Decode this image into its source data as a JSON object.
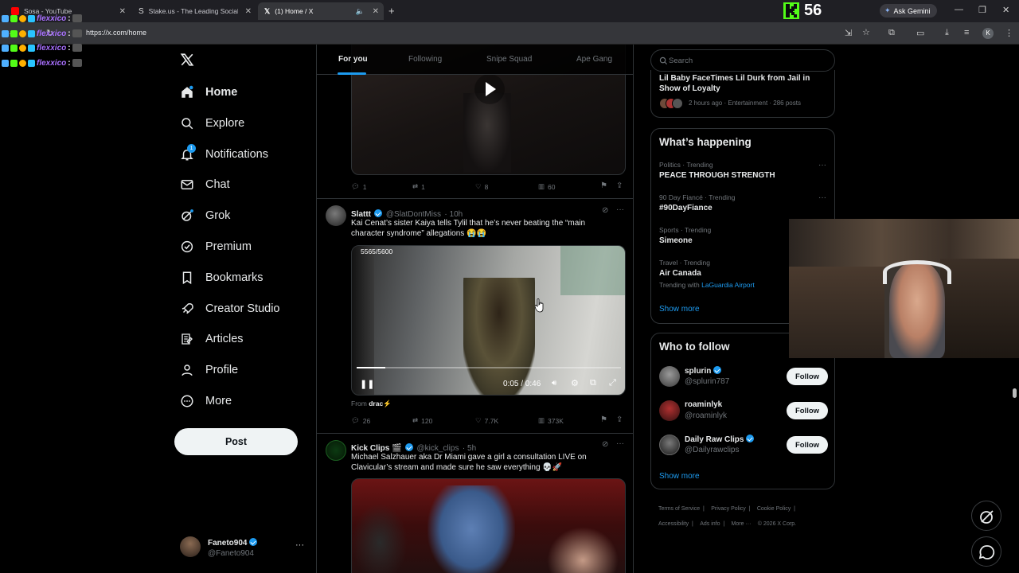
{
  "browser": {
    "tabs": [
      {
        "label": "Sosa - YouTube"
      },
      {
        "label": "Stake.us - The Leading Social C"
      },
      {
        "label": "(1) Home / X"
      }
    ],
    "url": "https://x.com/home",
    "new_tab": "+",
    "ask_gemini": "Ask Gemini",
    "kick_count": "56",
    "profile_letter": "K"
  },
  "overlay": {
    "chat_names": [
      "flexxico",
      "flexxico",
      "flexxico",
      "flexxico"
    ],
    "chat_sep": ":"
  },
  "nav": {
    "items": [
      {
        "label": "Home"
      },
      {
        "label": "Explore"
      },
      {
        "label": "Notifications",
        "badge": "1"
      },
      {
        "label": "Chat"
      },
      {
        "label": "Grok"
      },
      {
        "label": "Premium"
      },
      {
        "label": "Bookmarks"
      },
      {
        "label": "Creator Studio"
      },
      {
        "label": "Articles"
      },
      {
        "label": "Profile"
      },
      {
        "label": "More"
      }
    ],
    "post_label": "Post",
    "account": {
      "name": "Faneto904",
      "handle": "@Faneto904"
    }
  },
  "feed": {
    "tabs": [
      "For you",
      "Following",
      "Snipe Squad",
      "Ape Gang"
    ],
    "tweet0": {
      "replies": "1",
      "reposts": "1",
      "likes": "8",
      "views": "60"
    },
    "tweet1": {
      "name": "Slattt",
      "handle": "@SlatDontMiss",
      "time": "· 10h",
      "text": "Kai Cenat’s sister Kaiya tells Tylil that he’s never beating the “main character syndrome” allegations 😭😭",
      "video_counter": "5565/5600",
      "video_time": "0:05 / 0:46",
      "from_prefix": "From",
      "from_user": "drac⚡",
      "replies": "26",
      "reposts": "120",
      "likes": "7.7K",
      "views": "373K"
    },
    "tweet2": {
      "name": "Kick Clips 🎬",
      "handle": "@kick_clips",
      "time": "· 5h",
      "text": "Michael Salzhauer aka Dr Miami gave a girl a consultation LIVE on Clavicular’s stream and made sure he saw everything 💀🚀"
    }
  },
  "sidebar": {
    "search_placeholder": "Search",
    "top_news": {
      "title": "Lil Baby FaceTimes Lil Durk from Jail in Show of Loyalty",
      "meta": "2 hours ago · Entertainment · 286 posts"
    },
    "happening": {
      "title": "What’s happening",
      "trends": [
        {
          "meta": "Politics · Trending",
          "name": "PEACE THROUGH STRENGTH"
        },
        {
          "meta": "90 Day Fiancé · Trending",
          "name": "#90DayFiance"
        },
        {
          "meta": "Sports · Trending",
          "name": "Simeone"
        },
        {
          "meta": "Travel · Trending",
          "name": "Air Canada",
          "with_prefix": "Trending with",
          "with_link": "LaGuardia Airport"
        }
      ],
      "show_more": "Show more"
    },
    "who_to_follow": {
      "title": "Who to follow",
      "users": [
        {
          "name": "splurin",
          "handle": "@splurin787",
          "button": "Follow"
        },
        {
          "name": "roaminlyk",
          "handle": "@roaminlyk",
          "button": "Follow"
        },
        {
          "name": "Daily Raw Clips",
          "handle": "@Dailyrawclips",
          "button": "Follow"
        }
      ],
      "show_more": "Show more"
    },
    "footer": [
      "Terms of Service",
      "Privacy Policy",
      "Cookie Policy",
      "Accessibility",
      "Ads info",
      "More ···",
      "© 2026 X Corp."
    ]
  },
  "colors": {
    "accent": "#1d9bf0",
    "kick_green": "#53fc18",
    "background": "#000000"
  }
}
